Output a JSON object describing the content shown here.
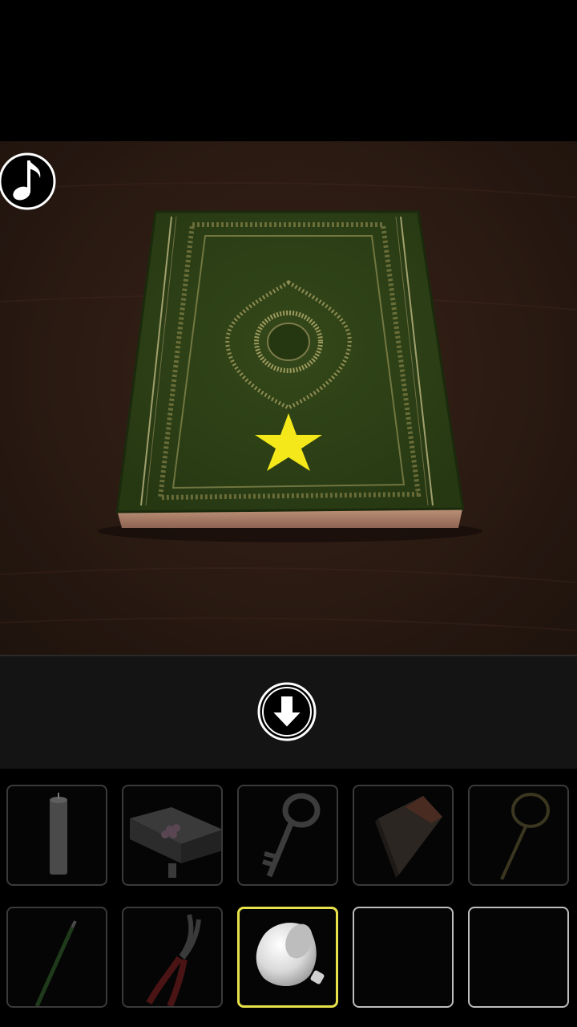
{
  "screen": {
    "scene": "book-closeup",
    "book_color": "#2e4016",
    "star_color": "#f4e81a",
    "selected_color": "#e8e24a"
  },
  "controls": {
    "music_icon": "music-note-icon",
    "back_icon": "arrow-down-icon"
  },
  "inventory": {
    "slots": [
      {
        "item": "candle",
        "state": "filled"
      },
      {
        "item": "flower-box",
        "state": "filled"
      },
      {
        "item": "key",
        "state": "filled"
      },
      {
        "item": "matchbox",
        "state": "filled"
      },
      {
        "item": "ring-wand",
        "state": "filled"
      },
      {
        "item": "brush",
        "state": "filled"
      },
      {
        "item": "pliers",
        "state": "filled"
      },
      {
        "item": "funnel",
        "state": "selected"
      },
      {
        "item": "",
        "state": "empty"
      },
      {
        "item": "",
        "state": "empty"
      }
    ]
  }
}
